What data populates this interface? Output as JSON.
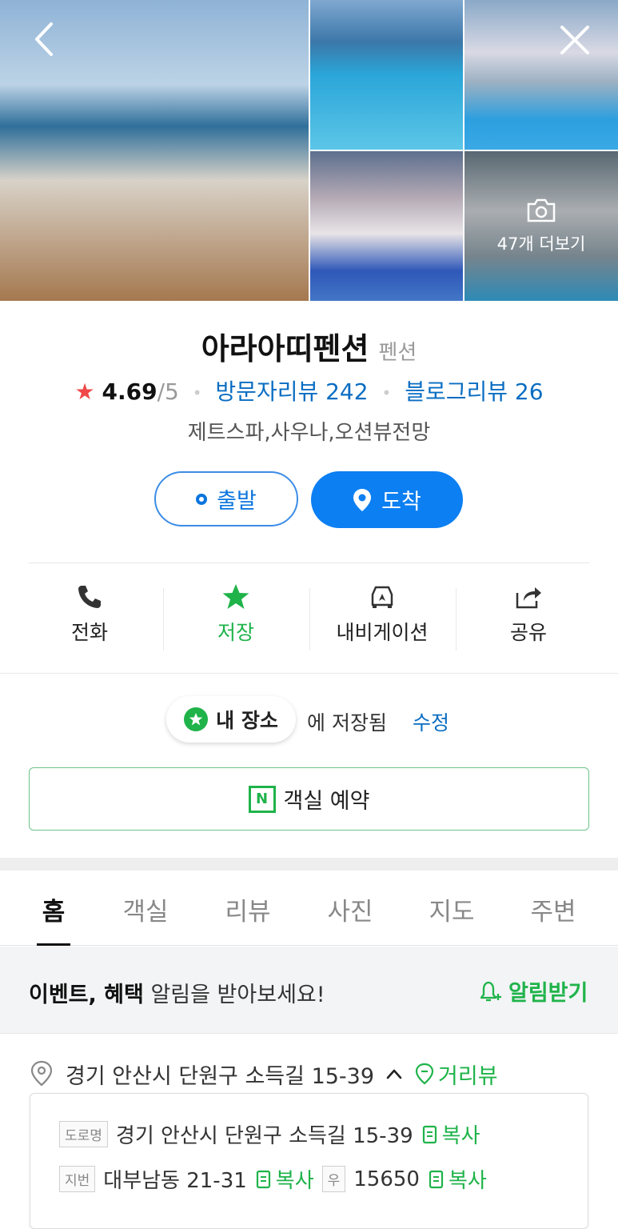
{
  "gallery": {
    "more_label": "47개 더보기"
  },
  "place": {
    "name": "아라아띠펜션",
    "category": "펜션",
    "rating": "4.69",
    "rating_max": "/5",
    "visitor_review": "방문자리뷰 242",
    "blog_review": "블로그리뷰 26",
    "description": "제트스파,사우나,오션뷰전망"
  },
  "route": {
    "departure_label": "출발",
    "arrival_label": "도착"
  },
  "actions": [
    {
      "label": "전화"
    },
    {
      "label": "저장"
    },
    {
      "label": "내비게이션"
    },
    {
      "label": "공유"
    }
  ],
  "saved": {
    "chip_label": "내 장소",
    "status_text": "에 저장됨",
    "edit_label": "수정"
  },
  "reserve": {
    "icon_letter": "N",
    "label": "객실 예약"
  },
  "tabs": [
    {
      "label": "홈"
    },
    {
      "label": "객실"
    },
    {
      "label": "리뷰"
    },
    {
      "label": "사진"
    },
    {
      "label": "지도"
    },
    {
      "label": "주변"
    }
  ],
  "notice": {
    "bold": "이벤트, 혜택",
    "text": " 알림을 받아보세요!",
    "button": "알림받기"
  },
  "address": {
    "main": "경기 안산시 단원구 소득길 15-39",
    "street_view": "거리뷰",
    "road_tag": "도로명",
    "road": "경기 안산시 단원구 소득길 15-39",
    "lot_tag": "지번",
    "lot": "대부남동 21-31",
    "zip_tag": "우",
    "zip": "15650",
    "copy_label": "복사"
  },
  "colors": {
    "primary_blue": "#0c7ff2",
    "naver_green": "#1fb34a",
    "star_red": "#f04848",
    "link_blue": "#0a6dc2"
  }
}
